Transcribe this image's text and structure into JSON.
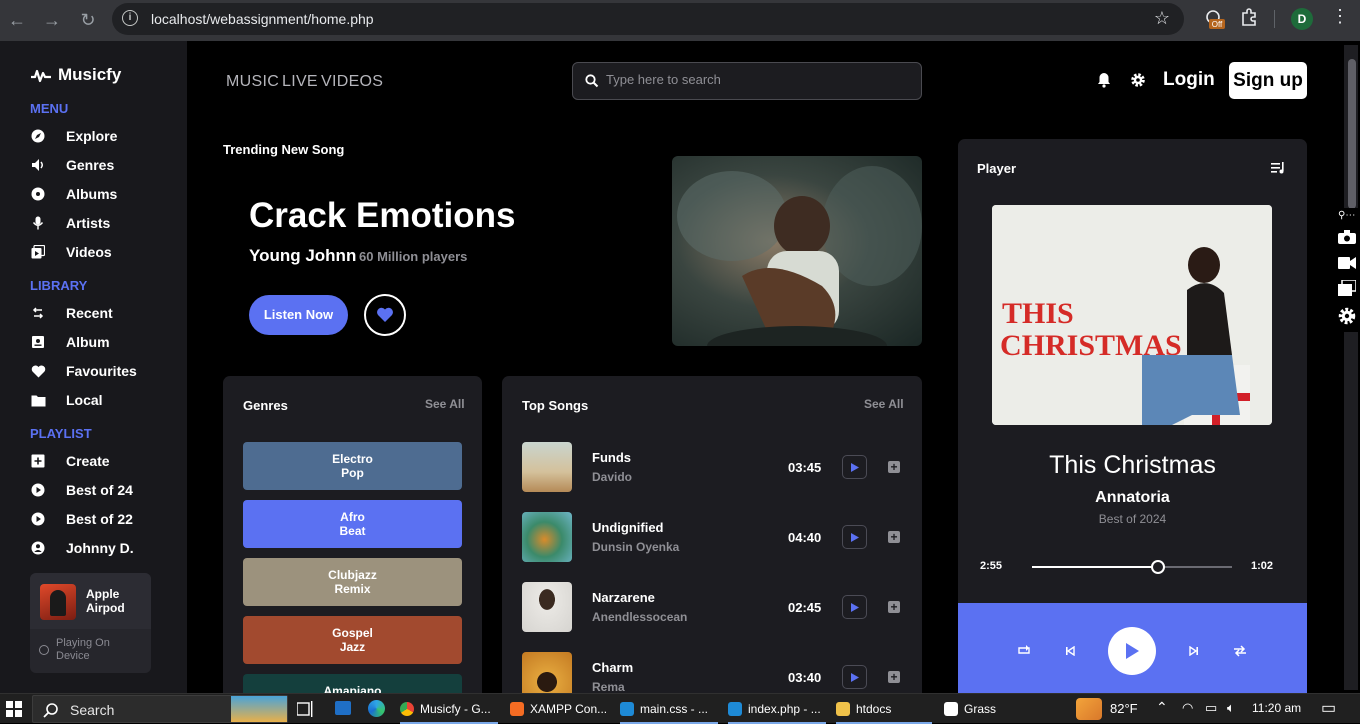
{
  "browser": {
    "url": "localhost/webassignment/home.php",
    "profile_initial": "D",
    "ext_badge": "Off"
  },
  "sidebar": {
    "brand": "Musicfy",
    "menu_title": "MENU",
    "menu": [
      {
        "label": "Explore",
        "icon": "compass-icon"
      },
      {
        "label": "Genres",
        "icon": "speaker-icon"
      },
      {
        "label": "Albums",
        "icon": "disc-icon"
      },
      {
        "label": "Artists",
        "icon": "microphone-icon"
      },
      {
        "label": "Videos",
        "icon": "video-library-icon"
      }
    ],
    "library_title": "LIBRARY",
    "library": [
      {
        "label": "Recent",
        "icon": "history-icon"
      },
      {
        "label": "Album",
        "icon": "album-icon"
      },
      {
        "label": "Favourites",
        "icon": "heart-icon"
      },
      {
        "label": "Local",
        "icon": "folder-icon"
      }
    ],
    "playlist_title": "PLAYLIST",
    "playlist": [
      {
        "label": "Create",
        "icon": "plus-square-icon"
      },
      {
        "label": "Best of 24",
        "icon": "play-circle-icon"
      },
      {
        "label": "Best of 22",
        "icon": "play-circle-icon"
      },
      {
        "label": "Johnny D.",
        "icon": "user-circle-icon"
      }
    ],
    "device": {
      "name": "Apple Airpod",
      "status": "Playing On Device"
    }
  },
  "header": {
    "nav": [
      "MUSIC",
      "LIVE",
      "VIDEOS"
    ],
    "search_placeholder": "Type here to search",
    "login": "Login",
    "signup": "Sign up"
  },
  "hero": {
    "label": "Trending New Song",
    "title": "Crack Emotions",
    "artist": "Young Johnn",
    "players": "60 Million players",
    "listen": "Listen Now"
  },
  "genres": {
    "title": "Genres",
    "see_all": "See All",
    "items": [
      {
        "label": "Electro\nPop",
        "color": "#4e6c91"
      },
      {
        "label": "Afro\nBeat",
        "color": "#5b71f2"
      },
      {
        "label": "Clubjazz\nRemix",
        "color": "#9c927d"
      },
      {
        "label": "Gospel\nJazz",
        "color": "#a24a2f"
      },
      {
        "label": "Amapiano",
        "color": "#143f3d"
      }
    ]
  },
  "top_songs": {
    "title": "Top Songs",
    "see_all": "See All",
    "items": [
      {
        "title": "Funds",
        "artist": "Davido",
        "duration": "03:45"
      },
      {
        "title": "Undignified",
        "artist": "Dunsin Oyenka",
        "duration": "04:40"
      },
      {
        "title": "Narzarene",
        "artist": "Anendlessocean",
        "duration": "02:45"
      },
      {
        "title": "Charm",
        "artist": "Rema",
        "duration": "03:40"
      }
    ]
  },
  "player": {
    "title": "Player",
    "cover_text": [
      "THIS",
      "CHRISTMAS"
    ],
    "song": "This Christmas",
    "artist": "Annatoria",
    "album": "Best of 2024",
    "elapsed": "2:55",
    "remaining": "1:02",
    "progress": 0.63
  },
  "taskbar": {
    "search": "Search",
    "apps": [
      "Musicfy - G...",
      "XAMPP Con...",
      "main.css - ...",
      "index.php - ...",
      "htdocs",
      "Grass"
    ],
    "weather": "82°F",
    "time": "11:20 am"
  },
  "colors": {
    "accent": "#5b71f2",
    "background": "#000000",
    "panel": "#1c1c21"
  }
}
